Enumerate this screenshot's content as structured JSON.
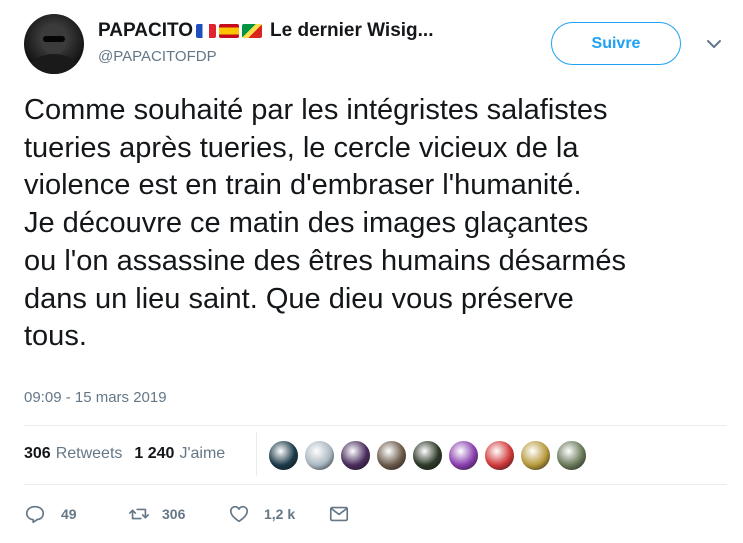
{
  "author": {
    "display_name": "PAPACITO",
    "name_suffix": "Le dernier Wisig...",
    "handle": "@PAPACITOFDP",
    "flags": [
      "flag-france",
      "flag-spain",
      "flag-congo"
    ]
  },
  "follow_button": {
    "label": "Suivre"
  },
  "tweet": {
    "text": "Comme souhaité par les intégristes salafistes\ntueries après tueries, le cercle vicieux de la\nviolence est en train d'embraser l'humanité.\nJe découvre ce matin des images glaçantes\nou l'on assassine des êtres humains désarmés\ndans un lieu saint. Que dieu vous préserve\ntous.",
    "timestamp": "09:09 - 15 mars 2019"
  },
  "stats": {
    "retweets_count": "306",
    "retweets_label": "Retweets",
    "likes_count": "1 240",
    "likes_label": "J'aime"
  },
  "liker_avatars": [
    {
      "name": "liker-avatar-1",
      "color": "#1c3a4a"
    },
    {
      "name": "liker-avatar-2",
      "color": "#aab8c2"
    },
    {
      "name": "liker-avatar-3",
      "color": "#4a2d5e"
    },
    {
      "name": "liker-avatar-4",
      "color": "#6b5a4a"
    },
    {
      "name": "liker-avatar-5",
      "color": "#2e3a2a"
    },
    {
      "name": "liker-avatar-6",
      "color": "#8a3fb0"
    },
    {
      "name": "liker-avatar-7",
      "color": "#d23a3a"
    },
    {
      "name": "liker-avatar-8",
      "color": "#b89a3c"
    },
    {
      "name": "liker-avatar-9",
      "color": "#6a7a5a"
    }
  ],
  "actions": {
    "reply_count": "49",
    "retweet_count": "306",
    "like_count": "1,2 k"
  },
  "colors": {
    "accent": "#1da1f2",
    "text_primary": "#14171a",
    "text_secondary": "#657786",
    "divider": "#e6ecf0"
  }
}
